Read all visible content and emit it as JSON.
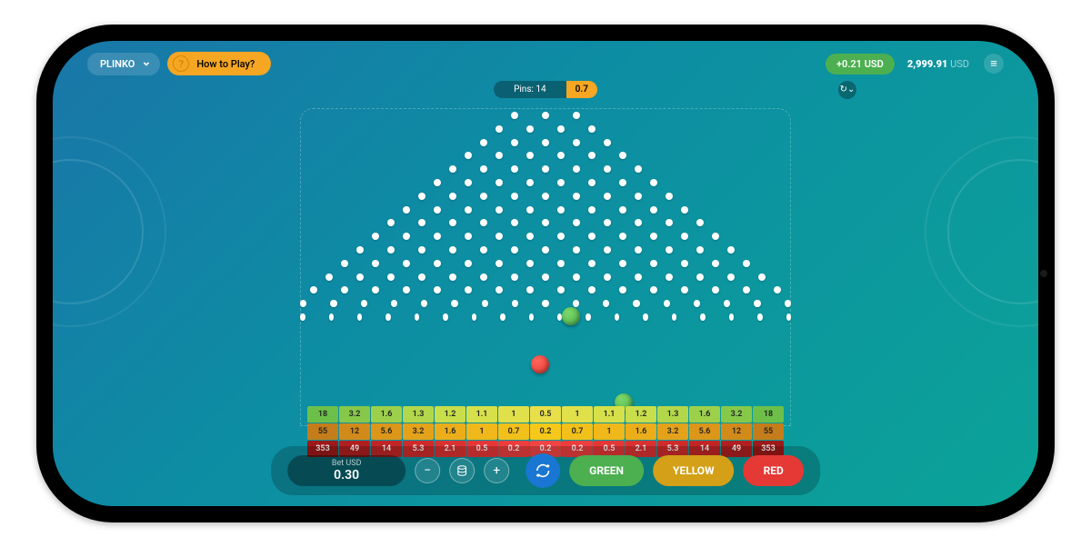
{
  "game_name": "PLINKO",
  "help_label": "How to Play?",
  "pins_label": "Pins: 14",
  "current_multiplier": "0.7",
  "win_amount": "+0.21 USD",
  "balance_value": "2,999.91",
  "balance_currency": "USD",
  "bet_label": "Bet USD",
  "bet_value": "0.30",
  "buttons": {
    "green": "GREEN",
    "yellow": "YELLOW",
    "red": "RED"
  },
  "payouts": {
    "green": [
      "18",
      "3.2",
      "1.6",
      "1.3",
      "1.2",
      "1.1",
      "1",
      "0.5",
      "1",
      "1.1",
      "1.2",
      "1.3",
      "1.6",
      "3.2",
      "18"
    ],
    "yellow": [
      "55",
      "12",
      "5.6",
      "3.2",
      "1.6",
      "1",
      "0.7",
      "0.2",
      "0.7",
      "1",
      "1.6",
      "3.2",
      "5.6",
      "12",
      "55"
    ],
    "red": [
      "353",
      "49",
      "14",
      "5.3",
      "2.1",
      "0.5",
      "0.2",
      "0.2",
      "0.2",
      "0.5",
      "2.1",
      "5.3",
      "14",
      "49",
      "353"
    ]
  },
  "colors": {
    "green_row": [
      "#6cc04a",
      "#86c94a",
      "#9dd04a",
      "#b3d74a",
      "#c8de4a",
      "#d6e04a",
      "#e0e04a",
      "#e8df4a",
      "#e0e04a",
      "#d6e04a",
      "#c8de4a",
      "#b3d74a",
      "#9dd04a",
      "#86c94a",
      "#6cc04a"
    ],
    "yellow_row": [
      "#c47d1a",
      "#d28a1a",
      "#dc961a",
      "#e4a21a",
      "#ebae1a",
      "#f0b81a",
      "#f2c01a",
      "#f5c81a",
      "#f2c01a",
      "#f0b81a",
      "#ebae1a",
      "#e4a21a",
      "#dc961a",
      "#d28a1a",
      "#c47d1a"
    ],
    "red_row": [
      "#9c1a1a",
      "#b02020",
      "#c02626",
      "#ce2c2c",
      "#da3232",
      "#e43838",
      "#ec3e3e",
      "#f24444",
      "#ec3e3e",
      "#e43838",
      "#da3232",
      "#ce2c2c",
      "#c02626",
      "#b02020",
      "#9c1a1a"
    ]
  },
  "pin_rows": 16
}
